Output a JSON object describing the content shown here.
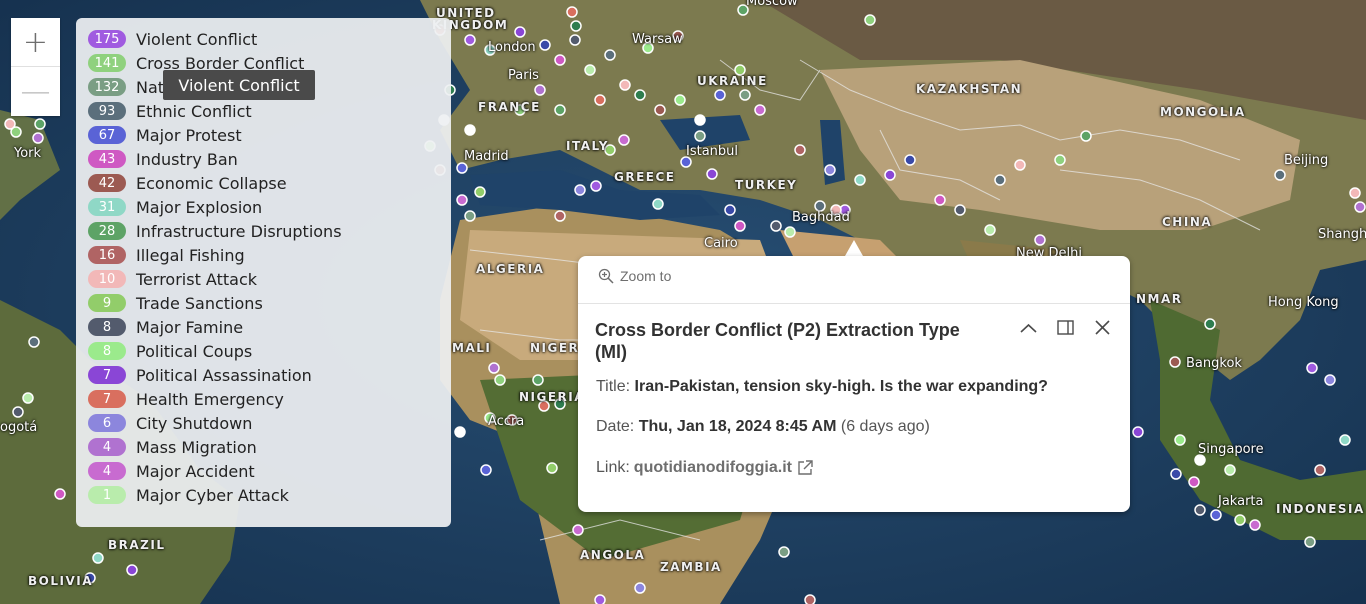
{
  "zoom": {
    "in_label": "+",
    "out_label": "—"
  },
  "legend": {
    "items": [
      {
        "count": "175",
        "label": "Violent Conflict",
        "color": "#a05be0"
      },
      {
        "count": "141",
        "label": "Cross Border Conflict",
        "color": "#8fd17e"
      },
      {
        "count": "132",
        "label": "Nat",
        "color": "#7a9e84"
      },
      {
        "count": "93",
        "label": "Ethnic Conflict",
        "color": "#5b6f7c"
      },
      {
        "count": "67",
        "label": "Major Protest",
        "color": "#5a63d6"
      },
      {
        "count": "43",
        "label": "Industry Ban",
        "color": "#cf59c3"
      },
      {
        "count": "42",
        "label": "Economic Collapse",
        "color": "#9c5a52"
      },
      {
        "count": "31",
        "label": "Major Explosion",
        "color": "#8fd8c6"
      },
      {
        "count": "28",
        "label": "Infrastructure Disruptions",
        "color": "#5da366"
      },
      {
        "count": "16",
        "label": "Illegal Fishing",
        "color": "#b06464"
      },
      {
        "count": "10",
        "label": "Terrorist Attack",
        "color": "#f2b8b8"
      },
      {
        "count": "9",
        "label": "Trade Sanctions",
        "color": "#92cd6a"
      },
      {
        "count": "8",
        "label": "Major Famine",
        "color": "#535b6d"
      },
      {
        "count": "8",
        "label": "Political Coups",
        "color": "#9bea8c"
      },
      {
        "count": "7",
        "label": "Political Assassination",
        "color": "#8a46d6"
      },
      {
        "count": "7",
        "label": "Health Emergency",
        "color": "#d96f5f"
      },
      {
        "count": "6",
        "label": "City Shutdown",
        "color": "#8c86dd"
      },
      {
        "count": "4",
        "label": "Mass Migration",
        "color": "#b072d0"
      },
      {
        "count": "4",
        "label": "Major Accident",
        "color": "#c86bd0"
      },
      {
        "count": "1",
        "label": "Major Cyber Attack",
        "color": "#b9ecac"
      }
    ]
  },
  "tooltip": {
    "text": "Violent Conflict"
  },
  "popup": {
    "zoom_to": "Zoom to",
    "title": "Cross Border Conflict (P2) Extraction Type (Ml)",
    "title_label": "Title:",
    "title_value": "Iran-Pakistan, tension sky-high. Is the war expanding?",
    "date_label": "Date:",
    "date_value": "Thu, Jan 18, 2024 8:45 AM",
    "date_relative": "(6 days ago)",
    "link_label": "Link:",
    "link_value": "quotidianodifoggia.it"
  },
  "map": {
    "labels": [
      {
        "text": "UNITED",
        "kind": "country"
      },
      {
        "text": "KINGDOM",
        "kind": "country"
      },
      {
        "text": "London",
        "kind": "city"
      },
      {
        "text": "Paris",
        "kind": "city"
      },
      {
        "text": "FRANCE",
        "kind": "country"
      },
      {
        "text": "Madrid",
        "kind": "city"
      },
      {
        "text": "ITALY",
        "kind": "country"
      },
      {
        "text": "Warsaw",
        "kind": "city"
      },
      {
        "text": "Moscow",
        "kind": "city"
      },
      {
        "text": "UKRAINE",
        "kind": "country"
      },
      {
        "text": "KAZAKHSTAN",
        "kind": "country"
      },
      {
        "text": "MONGOLIA",
        "kind": "country"
      },
      {
        "text": "Beijing",
        "kind": "city"
      },
      {
        "text": "Istanbul",
        "kind": "city"
      },
      {
        "text": "GREECE",
        "kind": "country"
      },
      {
        "text": "TURKEY",
        "kind": "country"
      },
      {
        "text": "Baghdad",
        "kind": "city"
      },
      {
        "text": "CHINA",
        "kind": "country"
      },
      {
        "text": "Shangh",
        "kind": "city"
      },
      {
        "text": "New Delhi",
        "kind": "city"
      },
      {
        "text": "Hong Kong",
        "kind": "city"
      },
      {
        "text": "ALGERIA",
        "kind": "country"
      },
      {
        "text": "MALI",
        "kind": "country"
      },
      {
        "text": "NIGER",
        "kind": "country"
      },
      {
        "text": "NIGERIA",
        "kind": "country"
      },
      {
        "text": "Accra",
        "kind": "city"
      },
      {
        "text": "Bangkok",
        "kind": "city"
      },
      {
        "text": "Singapore",
        "kind": "city"
      },
      {
        "text": "Jakarta",
        "kind": "city"
      },
      {
        "text": "INDONESIA",
        "kind": "country"
      },
      {
        "text": "ANGOLA",
        "kind": "country"
      },
      {
        "text": "ZAMBIA",
        "kind": "country"
      },
      {
        "text": "BRAZIL",
        "kind": "country"
      },
      {
        "text": "BOLIVIA",
        "kind": "country"
      },
      {
        "text": "York",
        "kind": "city"
      },
      {
        "text": "ogotá",
        "kind": "city"
      },
      {
        "text": "NMAR",
        "kind": "country"
      },
      {
        "text": "Cairo",
        "kind": "city"
      }
    ]
  }
}
